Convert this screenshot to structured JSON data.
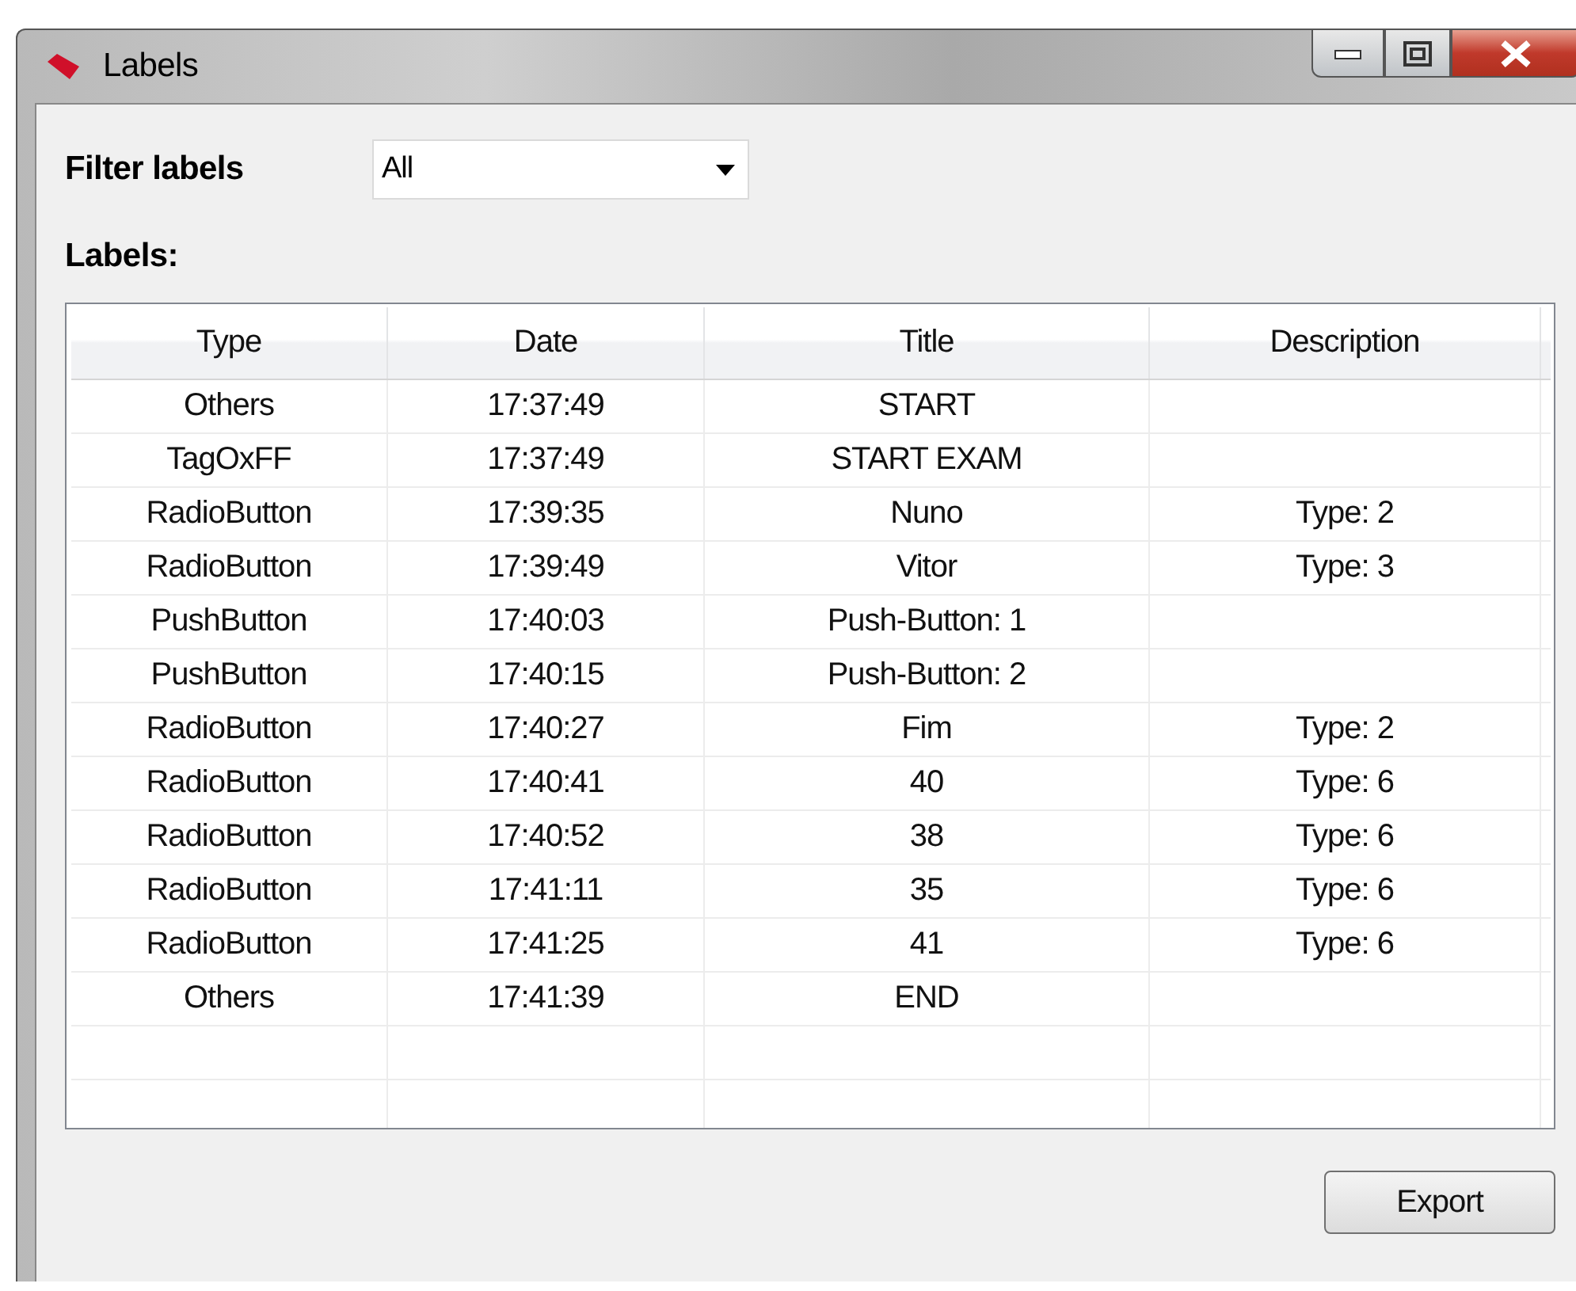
{
  "window": {
    "title": "Labels"
  },
  "filter": {
    "label": "Filter labels",
    "value": "All"
  },
  "list_label": "Labels:",
  "table": {
    "columns": [
      "Type",
      "Date",
      "Title",
      "Description"
    ],
    "rows": [
      [
        "Others",
        "17:37:49",
        "START",
        ""
      ],
      [
        "TagOxFF",
        "17:37:49",
        "START EXAM",
        ""
      ],
      [
        "RadioButton",
        "17:39:35",
        "Nuno",
        "Type: 2"
      ],
      [
        "RadioButton",
        "17:39:49",
        "Vitor",
        "Type: 3"
      ],
      [
        "PushButton",
        "17:40:03",
        "Push-Button: 1",
        ""
      ],
      [
        "PushButton",
        "17:40:15",
        "Push-Button: 2",
        ""
      ],
      [
        "RadioButton",
        "17:40:27",
        "Fim",
        "Type: 2"
      ],
      [
        "RadioButton",
        "17:40:41",
        "40",
        "Type: 6"
      ],
      [
        "RadioButton",
        "17:40:52",
        "38",
        "Type: 6"
      ],
      [
        "RadioButton",
        "17:41:11",
        "35",
        "Type: 6"
      ],
      [
        "RadioButton",
        "17:41:25",
        "41",
        "Type: 6"
      ],
      [
        "Others",
        "17:41:39",
        "END",
        ""
      ]
    ]
  },
  "buttons": [
    "Export"
  ]
}
